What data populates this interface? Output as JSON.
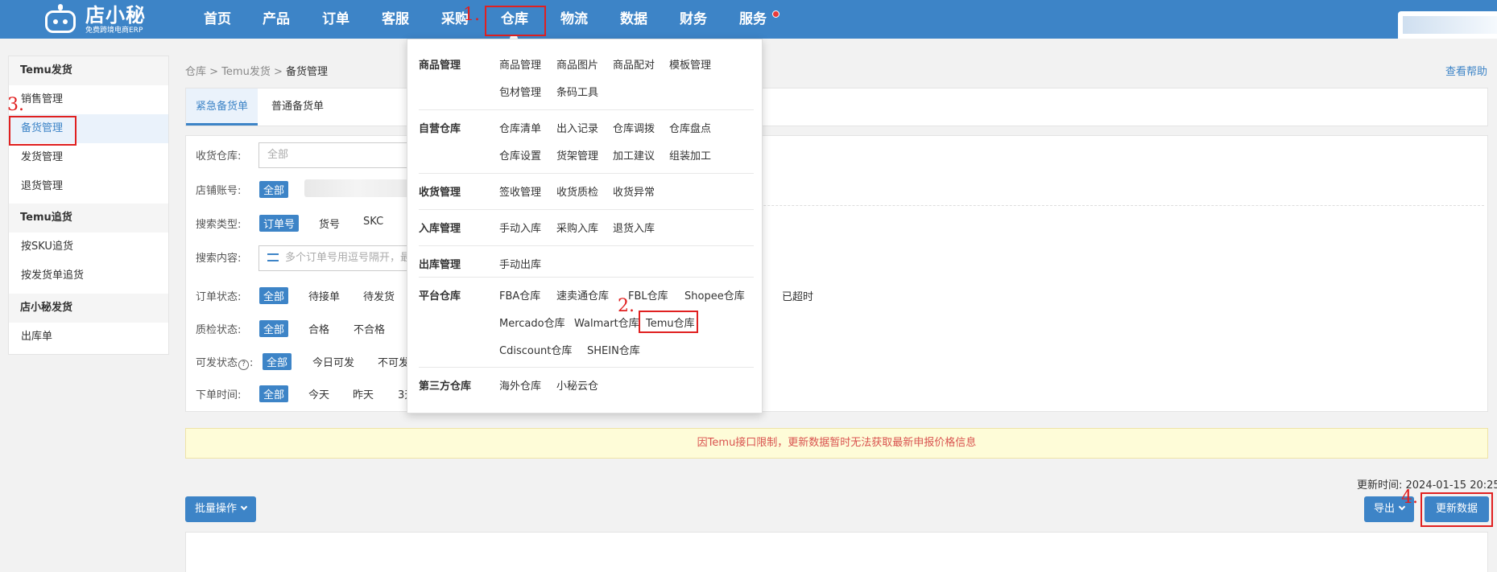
{
  "brand": {
    "name": "店小秘",
    "tagline": "免费跨境电商ERP"
  },
  "nav": {
    "items": [
      "首页",
      "产品",
      "订单",
      "客服",
      "采购",
      "仓库",
      "物流",
      "数据",
      "财务",
      "服务"
    ],
    "active": "仓库"
  },
  "annotations": [
    "1.",
    "2.",
    "3.",
    "4."
  ],
  "sidebar": {
    "groups": [
      {
        "title": "Temu发货",
        "items": [
          "销售管理",
          "备货管理",
          "发货管理",
          "退货管理"
        ]
      },
      {
        "title": "Temu追货",
        "items": [
          "按SKU追货",
          "按发货单追货"
        ]
      },
      {
        "title": "店小秘发货",
        "items": [
          "出库单"
        ]
      }
    ],
    "active_item": "备货管理"
  },
  "breadcrumb": {
    "parts": [
      "仓库",
      "Temu发货",
      "备货管理"
    ],
    "sep": ">"
  },
  "help_link": "查看帮助",
  "tabs": [
    "紧急备货单",
    "普通备货单"
  ],
  "filters": {
    "warehouse": {
      "label": "收货仓库:",
      "placeholder": "全部"
    },
    "shop": {
      "label": "店铺账号:",
      "selected": "全部"
    },
    "search_type": {
      "label": "搜索类型:",
      "options": [
        "订单号",
        "货号",
        "SKC"
      ]
    },
    "search_content": {
      "label": "搜索内容:",
      "placeholder": "多个订单号用逗号隔开，最"
    },
    "order_status": {
      "label": "订单状态:",
      "options": [
        "全部",
        "待接单",
        "待发货"
      ],
      "extra": "已超时"
    },
    "qc_status": {
      "label": "质检状态:",
      "options": [
        "全部",
        "合格",
        "不合格"
      ]
    },
    "ship_status": {
      "label": "可发状态",
      "options": [
        "全部",
        "今日可发",
        "不可发"
      ]
    },
    "order_time": {
      "label": "下单时间:",
      "options": [
        "全部",
        "今天",
        "昨天",
        "3天"
      ]
    }
  },
  "notice": "因Temu接口限制，更新数据暂时无法获取最新申报价格信息",
  "update_time": "更新时间: 2024-01-15 20:25",
  "buttons": {
    "batch": "批量操作",
    "export": "导出",
    "update": "更新数据"
  },
  "dropdown": {
    "categories": [
      {
        "title": "商品管理",
        "links": [
          "商品管理",
          "商品图片",
          "商品配对",
          "模板管理",
          "包材管理",
          "条码工具"
        ]
      },
      {
        "title": "自营仓库",
        "links": [
          "仓库清单",
          "出入记录",
          "仓库调拨",
          "仓库盘点",
          "仓库设置",
          "货架管理",
          "加工建议",
          "组装加工"
        ]
      },
      {
        "title": "收货管理",
        "links": [
          "签收管理",
          "收货质检",
          "收货异常"
        ]
      },
      {
        "title": "入库管理",
        "links": [
          "手动入库",
          "采购入库",
          "退货入库"
        ]
      },
      {
        "title": "出库管理",
        "links": [
          "手动出库"
        ]
      },
      {
        "title": "平台仓库",
        "links": [
          "FBA仓库",
          "速卖通仓库",
          "FBL仓库",
          "Shopee仓库",
          "Mercado仓库",
          "Walmart仓库",
          "Temu仓库",
          "Cdiscount仓库",
          "SHEIN仓库"
        ]
      },
      {
        "title": "第三方仓库",
        "links": [
          "海外仓库",
          "小秘云仓"
        ]
      }
    ]
  },
  "colors": {
    "primary": "#3d84c7",
    "annotation": "#e02020",
    "notice_bg": "#fefcd8",
    "notice_text": "#d9534f"
  }
}
